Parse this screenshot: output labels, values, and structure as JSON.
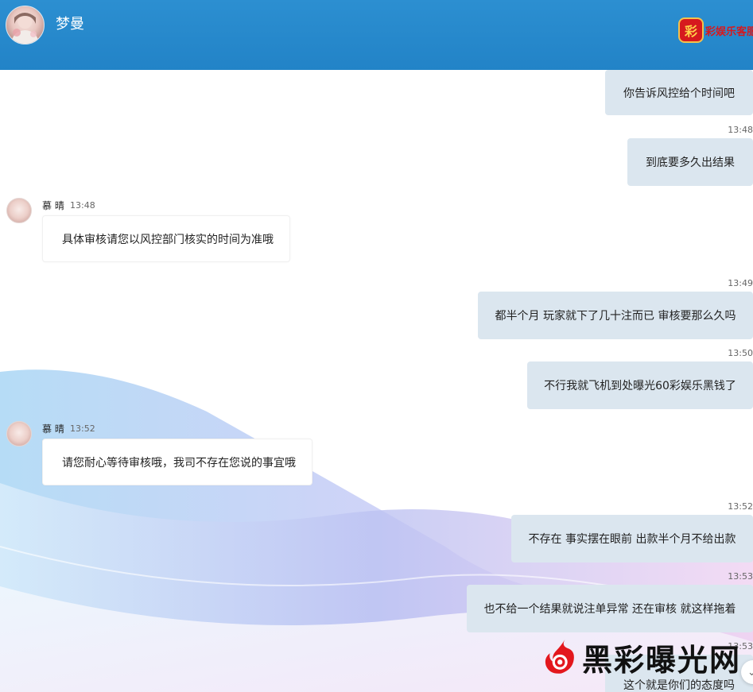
{
  "header": {
    "title": "梦曼",
    "avatar_icon": "user-avatar-icon",
    "brand_logo_char": "彩",
    "brand_text": "彩娱乐客服"
  },
  "chat": {
    "messages": [
      {
        "side": "out",
        "text": "你告诉风控给个时间吧"
      },
      {
        "side": "out",
        "time": "13:48",
        "text": "到底要多久出结果"
      },
      {
        "side": "in",
        "sender": "慕 晴",
        "time": "13:48",
        "text": "具体审核请您以风控部门核实的时间为准哦"
      },
      {
        "side": "out",
        "time": "13:49",
        "text": "都半个月 玩家就下了几十注而已 审核要那么久吗"
      },
      {
        "side": "out",
        "time": "13:50",
        "text": "不行我就飞机到处曝光60彩娱乐黑钱了"
      },
      {
        "side": "in",
        "sender": "慕 晴",
        "time": "13:52",
        "text": "请您耐心等待审核哦，我司不存在您说的事宜哦"
      },
      {
        "side": "out",
        "time": "13:52",
        "text": "不存在 事实摆在眼前 出款半个月不给出款"
      },
      {
        "side": "out",
        "time": "13:53",
        "text": "也不给一个结果就说注单异常 还在审核 就这样拖着"
      },
      {
        "side": "out",
        "time": "13:53",
        "text": "这个就是你们的态度吗"
      }
    ]
  },
  "watermark": {
    "text": "黑彩曝光网",
    "logo_icon": "flame-eye-logo-icon"
  },
  "scroll_button": {
    "icon": "chevron-down-icon",
    "glyph": "⌄"
  }
}
